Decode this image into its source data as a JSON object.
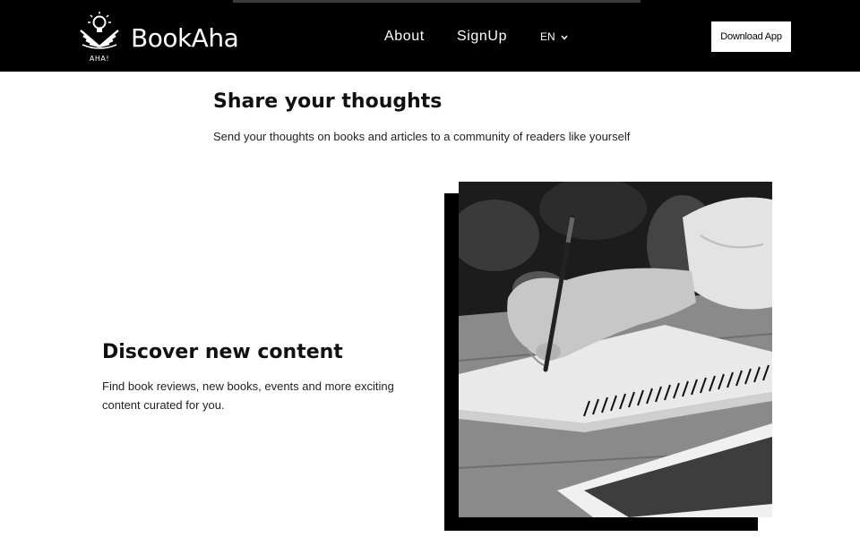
{
  "header": {
    "brand": "BookAha",
    "logo_text": "AHA!",
    "nav": {
      "about": "About",
      "signup": "SignUp"
    },
    "language": {
      "selected": "EN",
      "icon": "chevron-down-icon"
    },
    "download_button": "Download App"
  },
  "sections": {
    "share": {
      "title": "Share your thoughts",
      "text": "Send your thoughts on books and articles to a community of readers like yourself"
    },
    "discover": {
      "title": "Discover new content",
      "text": "Find book reviews, new books, events and more exciting content curated for you."
    }
  },
  "colors": {
    "header_bg": "#000000",
    "page_bg": "#ffffff",
    "accent": "#000000"
  }
}
